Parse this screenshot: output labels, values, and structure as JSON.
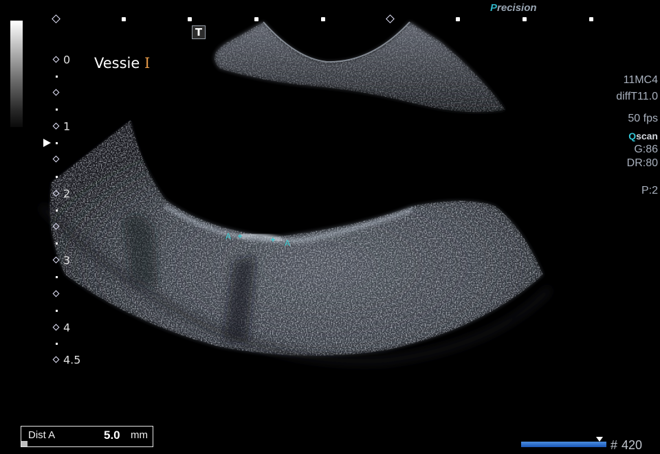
{
  "brand": {
    "first_letter": "P",
    "rest": "recision"
  },
  "organ_label": "Vessie",
  "cursor_glyph": "I",
  "depth_scale": {
    "labels": [
      "0",
      "1",
      "2",
      "3",
      "4",
      "4.5"
    ],
    "unit_note": ""
  },
  "params": {
    "probe": "11MC4",
    "preset": "diffT11.0",
    "frame_rate": "50 fps",
    "qscan_q": "Q",
    "qscan_rest": "scan",
    "gain": "G:86",
    "dynamic_range": "DR:80",
    "power": "P:2"
  },
  "caliper": {
    "letter_a": "A",
    "letter_b": "A",
    "cross": "+"
  },
  "measurement": {
    "label": "Dist A",
    "value": "5.0",
    "unit": "mm"
  },
  "cine": {
    "hash": "#",
    "frame": "420",
    "position_fraction": 0.92
  },
  "icons": {
    "t_button": "T",
    "focus_marker": "focus-arrow-icon"
  },
  "colors": {
    "caliper": "#39c9cf",
    "brand_accent": "#2fb2c4",
    "cine_bar": "#2f6fcf"
  }
}
